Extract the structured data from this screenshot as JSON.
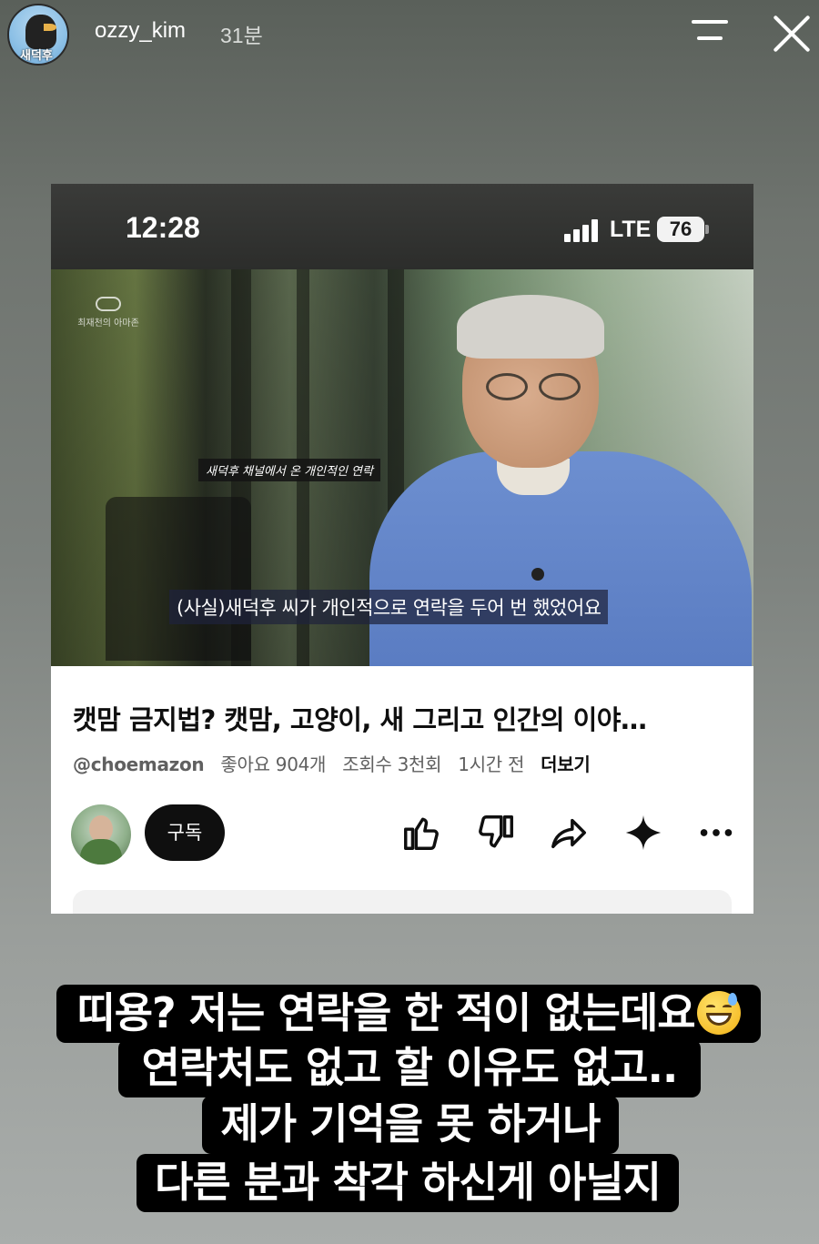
{
  "story": {
    "username": "ozzy_kim",
    "time_ago": "31분",
    "avatar_text": "새덕후"
  },
  "embedded": {
    "status_bar": {
      "time": "12:28",
      "network": "LTE",
      "battery": "76"
    },
    "video": {
      "channel_logo_text": "최재천의 아마존",
      "caption_top": "새덕후 채널에서 온 개인적인 연락",
      "caption_bottom": "(사실)새덕후 씨가 개인적으로 연락을 두어 번 했었어요",
      "progress": 0.03
    },
    "info": {
      "title": "캣맘 금지법? 캣맘, 고양이, 새 그리고 인간의 이야…",
      "handle": "@choemazon",
      "likes": "좋아요 904개",
      "views": "조회수 3천회",
      "posted": "1시간 전",
      "more": "더보기",
      "subscribe": "구독"
    }
  },
  "overlay_text": {
    "line1": "띠용? 저는 연락을 한 적이 없는데요",
    "line2": "연락처도 없고 할 이유도 없고..",
    "line3": "제가 기억을 못 하거나",
    "line4": "다른 분과 착각 하신게 아닐지"
  },
  "colors": {
    "progress": "#ff0000",
    "subscribe_bg": "#0f0f0f",
    "overlay_bg": "#000000"
  }
}
